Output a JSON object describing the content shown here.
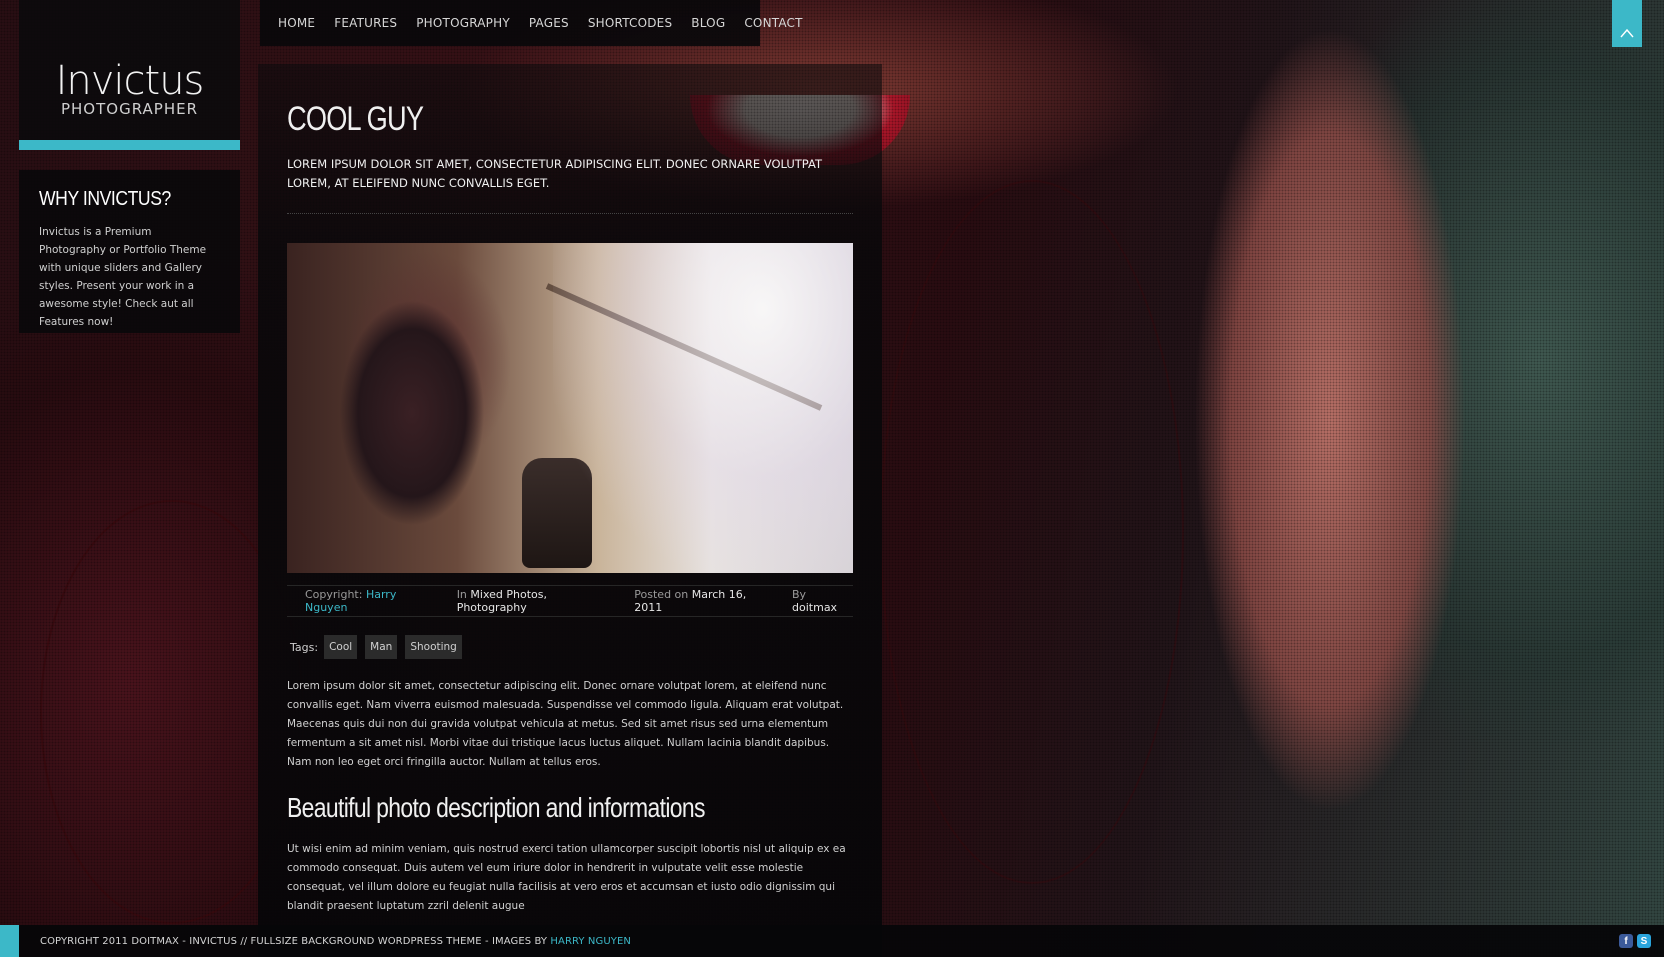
{
  "brand": {
    "name": "Invictus",
    "tagline": "PHOTOGRAPHER",
    "accent": "#3cb8c8"
  },
  "nav": {
    "items": [
      "HOME",
      "FEATURES",
      "PHOTOGRAPHY",
      "PAGES",
      "SHORTCODES",
      "BLOG",
      "CONTACT"
    ]
  },
  "widget": {
    "title": "WHY INVICTUS?",
    "text": "Invictus is a Premium Photography or Portfolio Theme with unique sliders and Gallery styles. Present your work in a awesome style! Check aut all Features now!"
  },
  "post": {
    "title": "COOL GUY",
    "intro": "LOREM IPSUM DOLOR SIT AMET, CONSECTETUR ADIPISCING ELIT. DONEC ORNARE VOLUTPAT LOREM, AT ELEIFEND NUNC CONVALLIS EGET.",
    "meta": {
      "copyright_label": "Copyright:",
      "copyright_value": "Harry Nguyen",
      "in_label": "In",
      "in_value": "Mixed Photos, Photography",
      "posted_label": "Posted on",
      "posted_value": "March 16, 2011",
      "by_label": "By",
      "by_value": "doitmax"
    },
    "tags_label": "Tags:",
    "tags": [
      "Cool",
      "Man",
      "Shooting"
    ],
    "paragraph1": "Lorem ipsum dolor sit amet, consectetur adipiscing elit. Donec ornare volutpat lorem, at eleifend nunc convallis eget. Nam viverra euismod malesuada. Suspendisse vel commodo ligula. Aliquam erat volutpat. Maecenas quis dui non dui gravida volutpat vehicula at metus. Sed sit amet risus sed urna elementum fermentum a sit amet nisl. Morbi vitae dui tristique lacus luctus aliquet. Nullam lacinia blandit dapibus. Nam non leo eget orci fringilla auctor. Nullam at tellus eros.",
    "subheading": "Beautiful photo description and informations",
    "paragraph2": "Ut wisi enim ad minim veniam, quis nostrud exerci tation ullamcorper suscipit lobortis nisl ut aliquip ex ea commodo consequat. Duis autem vel eum iriure dolor in hendrerit in vulputate velit esse molestie consequat, vel illum dolore eu feugiat nulla facilisis at vero eros et accumsan et iusto odio dignissim qui blandit praesent luptatum zzril delenit augue"
  },
  "footer": {
    "copyright": "COPYRIGHT 2011 DOITMAX - INVICTUS // FULLSIZE BACKGROUND WORDPRESS THEME - IMAGES BY",
    "credit": "HARRY NGUYEN",
    "social_icons": [
      "facebook-icon",
      "skype-icon"
    ]
  },
  "back_to_top_icon": "chevron-up-icon"
}
